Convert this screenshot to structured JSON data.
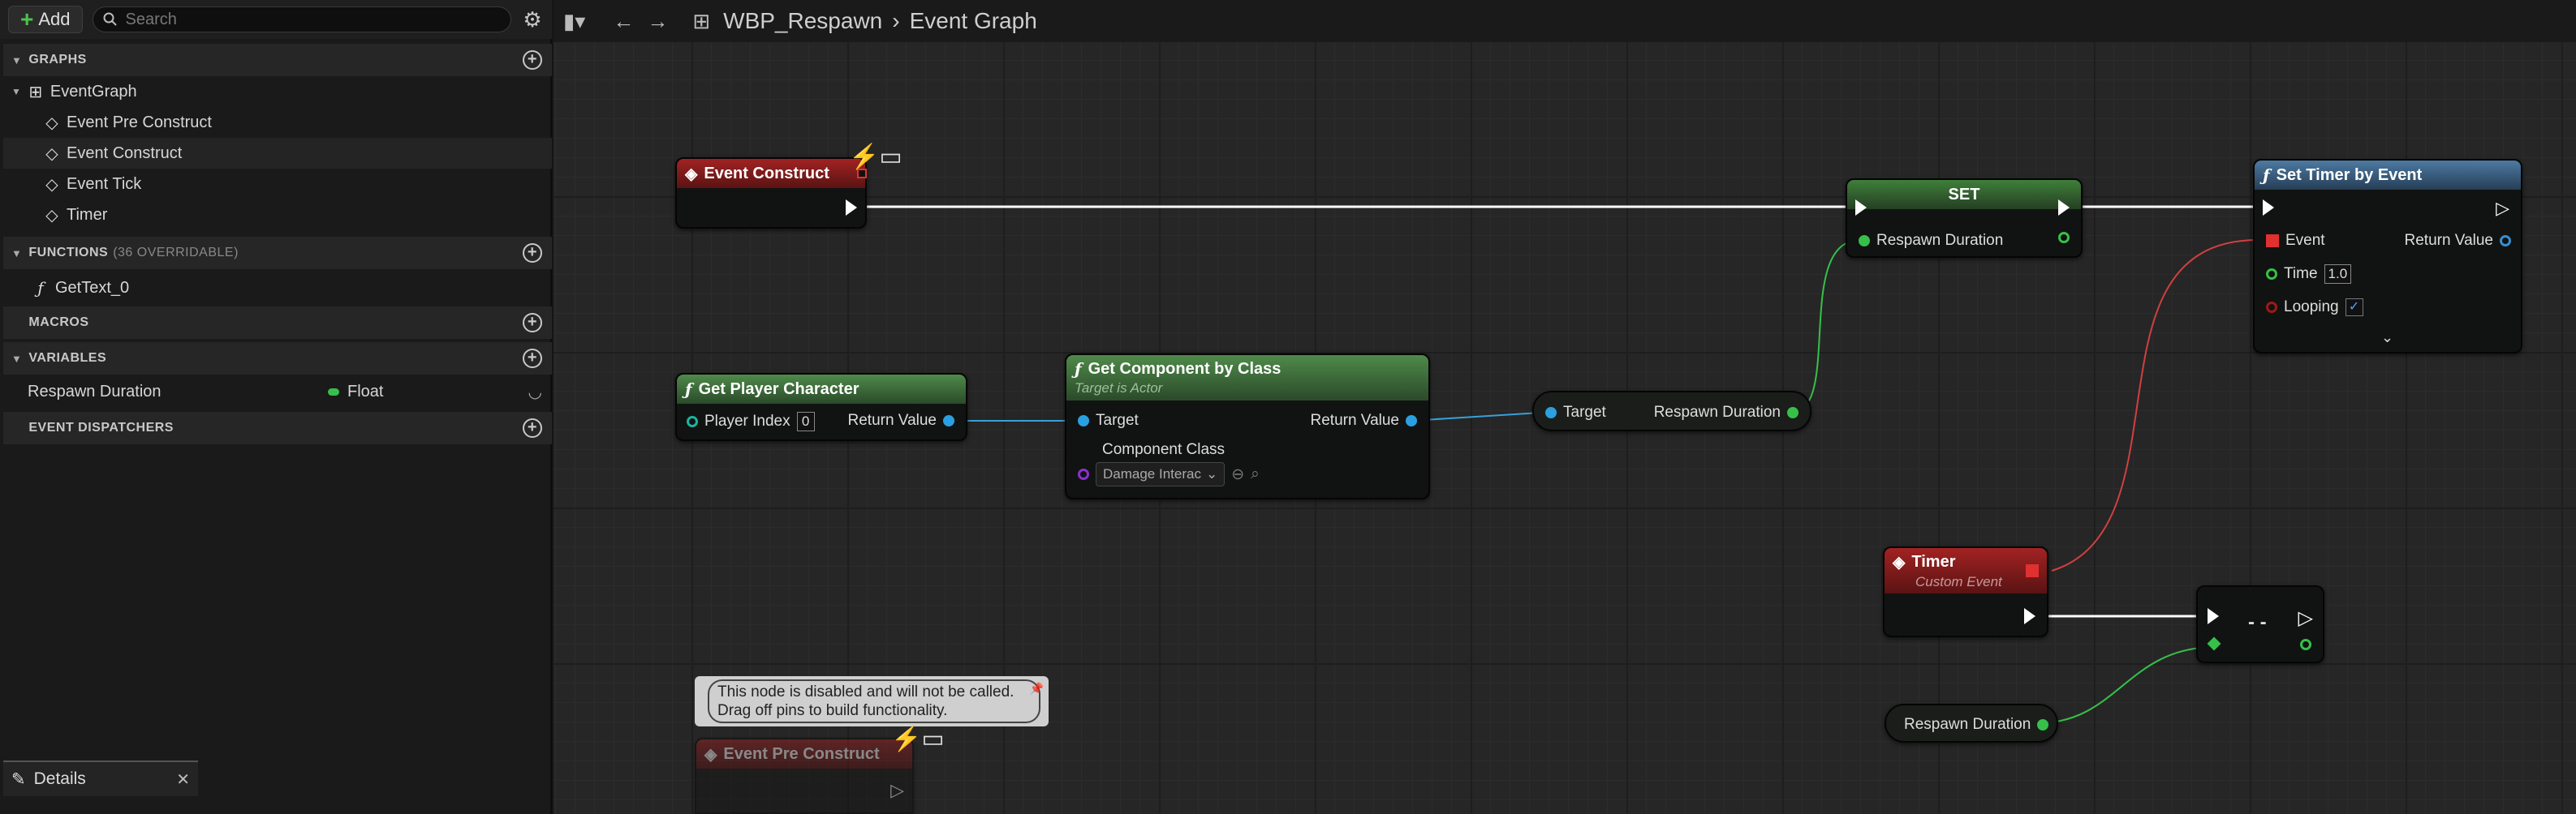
{
  "toolbar": {
    "add_label": "Add",
    "search_placeholder": "Search"
  },
  "sections": {
    "graphs": "GRAPHS",
    "functions": "FUNCTIONS",
    "functions_count": "(36 OVERRIDABLE)",
    "macros": "MACROS",
    "variables": "VARIABLES",
    "event_dispatchers": "EVENT DISPATCHERS"
  },
  "graphs": {
    "root": "EventGraph",
    "items": [
      "Event Pre Construct",
      "Event Construct",
      "Event Tick",
      "Timer"
    ]
  },
  "functions": [
    "GetText_0"
  ],
  "variables": [
    {
      "name": "Respawn Duration",
      "type": "Float",
      "type_color": "#36c04a"
    }
  ],
  "details_tab": {
    "label": "Details"
  },
  "breadcrumb": {
    "asset": "WBP_Respawn",
    "graph": "Event Graph"
  },
  "nodes": {
    "event_construct": {
      "title": "Event Construct"
    },
    "set": {
      "title": "SET",
      "pin": "Respawn Duration"
    },
    "set_timer": {
      "title": "Set Timer by Event",
      "event": "Event",
      "return": "Return Value",
      "time": "Time",
      "time_value": "1.0",
      "looping": "Looping"
    },
    "get_player_character": {
      "title": "Get Player Character",
      "player_index": "Player Index",
      "player_index_value": "0",
      "return": "Return Value"
    },
    "get_component": {
      "title": "Get Component by Class",
      "subtitle": "Target is Actor",
      "target": "Target",
      "component_class": "Component Class",
      "class_value": "Damage Interac",
      "return": "Return Value"
    },
    "get_var": {
      "target": "Target",
      "out": "Respawn Duration"
    },
    "timer_event": {
      "title": "Timer",
      "subtitle": "Custom Event"
    },
    "reroute": {
      "label": "- -"
    },
    "respawn_var": {
      "label": "Respawn Duration"
    },
    "disabled_pre_construct": {
      "title": "Event Pre Construct"
    }
  },
  "comment": {
    "line1": "This node is disabled and will not be called.",
    "line2": "Drag off pins to build functionality."
  }
}
